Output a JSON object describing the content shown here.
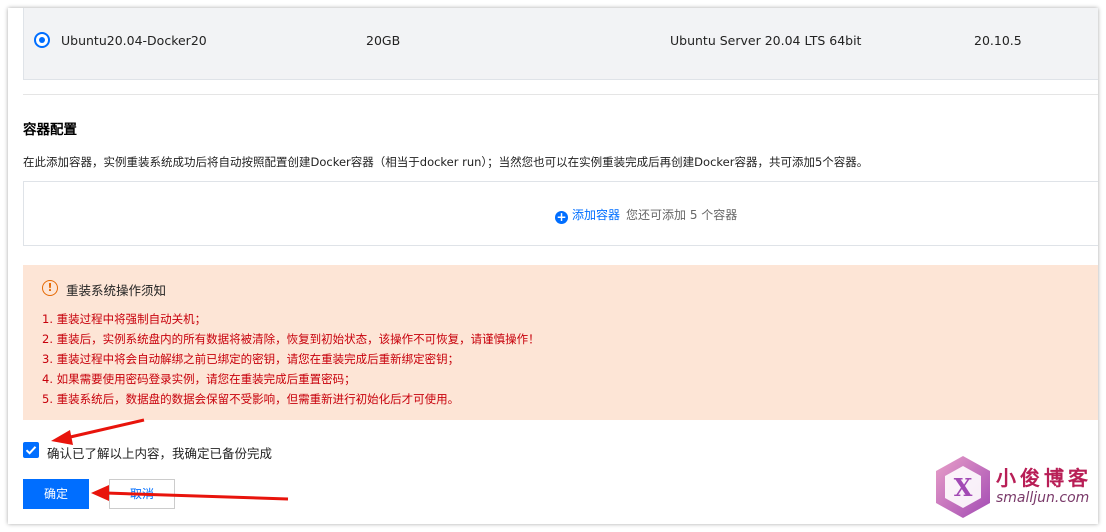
{
  "image_row": {
    "name": "Ubuntu20.04-Docker20",
    "size": "20GB",
    "os": "Ubuntu Server 20.04 LTS 64bit",
    "version": "20.10.5"
  },
  "container": {
    "title": "容器配置",
    "description": "在此添加容器，实例重装系统成功后将自动按照配置创建Docker容器（相当于docker run）；当然您也可以在实例重装完成后再创建Docker容器，共可添加5个容器。",
    "add_label": "添加容器",
    "add_hint": "您还可添加 5 个容器"
  },
  "notice": {
    "title": "重装系统操作须知",
    "items": [
      "1. 重装过程中将强制自动关机；",
      "2. 重装后，实例系统盘内的所有数据将被清除，恢复到初始状态，该操作不可恢复，请谨慎操作！",
      "3. 重装过程中将会自动解绑之前已绑定的密钥，请您在重装完成后重新绑定密钥；",
      "4. 如果需要使用密码登录实例，请您在重装完成后重置密码；",
      "5. 重装系统后，数据盘的数据会保留不受影响，但需重新进行初始化后才可使用。"
    ]
  },
  "confirm": {
    "checkbox_label": "确认已了解以上内容，我确定已备份完成",
    "checked": true
  },
  "buttons": {
    "confirm": "确定",
    "cancel": "取消"
  },
  "watermark": {
    "cn": "小俊博客",
    "en": "smalljun.com",
    "letter": "X"
  },
  "colors": {
    "accent": "#006eff",
    "notice_bg": "#fde5d6",
    "notice_text": "#c7000b",
    "warning": "#e56a05",
    "arrow": "#e8140c"
  }
}
